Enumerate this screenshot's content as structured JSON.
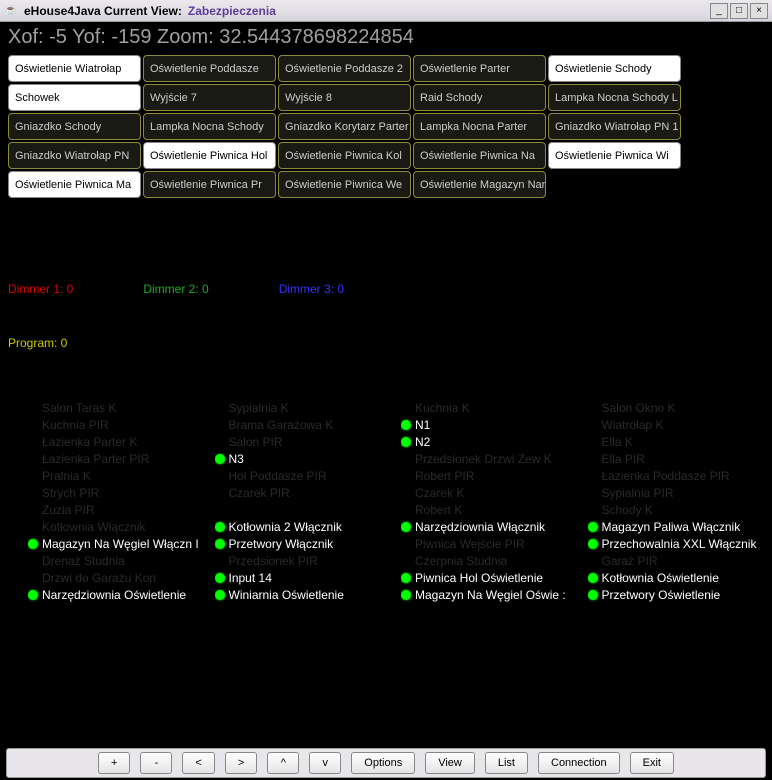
{
  "title": {
    "prefix": "eHouse4Java Current View:",
    "view": "Zabezpieczenia"
  },
  "win_buttons": {
    "min": "_",
    "max": "□",
    "close": "×"
  },
  "coords": "Xof: -5 Yof: -159 Zoom: 32.544378698224854",
  "cells": [
    {
      "label": "Oświetlenie Wiatrołap",
      "light": true
    },
    {
      "label": "Oświetlenie Poddasze",
      "light": false
    },
    {
      "label": "Oświetlenie Poddasze 2",
      "light": false
    },
    {
      "label": "Oświetlenie Parter",
      "light": false
    },
    {
      "label": "Oświetlenie Schody",
      "light": true
    },
    {
      "label": "Schowek",
      "light": true
    },
    {
      "label": "Wyjście 7",
      "light": false
    },
    {
      "label": "Wyjście 8",
      "light": false
    },
    {
      "label": "Raid Schody",
      "light": false
    },
    {
      "label": "Lampka Nocna Schody L",
      "light": false
    },
    {
      "label": "Gniazdko Schody",
      "light": false
    },
    {
      "label": "Lampka Nocna Schody",
      "light": false
    },
    {
      "label": "Gniazdko Korytarz Parter",
      "light": false
    },
    {
      "label": "Lampka Nocna Parter",
      "light": false
    },
    {
      "label": "Gniazdko Wiatrołap PN 1",
      "light": false
    },
    {
      "label": "Gniazdko Wiatrołap PN",
      "light": false
    },
    {
      "label": "Oświetlenie Piwnica Hol",
      "light": true
    },
    {
      "label": "Oświetlenie Piwnica Kol",
      "light": false
    },
    {
      "label": "Oświetlenie Piwnica Na",
      "light": false
    },
    {
      "label": "Oświetlenie Piwnica Wi",
      "light": true
    },
    {
      "label": "Oświetlenie Piwnica Ma",
      "light": true
    },
    {
      "label": "Oświetlenie Piwnica Pr",
      "light": false
    },
    {
      "label": "Oświetlenie Piwnica We",
      "light": false
    },
    {
      "label": "Oświetlenie Magazyn Narzędzia",
      "light": false
    }
  ],
  "dimmers": [
    {
      "label": "Dimmer 1: 0",
      "cls": "dimmer-red"
    },
    {
      "label": "Dimmer 2: 0",
      "cls": "dimmer-green"
    },
    {
      "label": "Dimmer 3: 0",
      "cls": "dimmer-blue"
    }
  ],
  "program": "Program: 0",
  "status_cols": [
    [
      {
        "label": "Salon Taras K",
        "dot": false,
        "on": false
      },
      {
        "label": "Kuchnia PIR",
        "dot": false,
        "on": false
      },
      {
        "label": "Łazienka Parter K",
        "dot": false,
        "on": false
      },
      {
        "label": "Łazienka Parter PIR",
        "dot": false,
        "on": false
      },
      {
        "label": "Pralnia K",
        "dot": false,
        "on": false
      },
      {
        "label": "Strych PIR",
        "dot": false,
        "on": false
      },
      {
        "label": "Zuzia PIR",
        "dot": false,
        "on": false
      },
      {
        "label": "Kotłownia Włącznik",
        "dot": false,
        "on": false
      },
      {
        "label": "Magazyn Na Węgiel Włączn I",
        "dot": true,
        "on": true
      },
      {
        "label": "Drenaż Studnia",
        "dot": false,
        "on": false
      },
      {
        "label": "Drzwi do Garażu Kon",
        "dot": false,
        "on": false
      },
      {
        "label": "Narzędziownia Oświetlenie",
        "dot": true,
        "on": true
      }
    ],
    [
      {
        "label": "Sypialnia K",
        "dot": false,
        "on": false
      },
      {
        "label": "Brama Garażowa K",
        "dot": false,
        "on": false
      },
      {
        "label": "Salon PIR",
        "dot": false,
        "on": false
      },
      {
        "label": "N3",
        "dot": true,
        "on": true
      },
      {
        "label": "Hol Poddasze PIR",
        "dot": false,
        "on": false
      },
      {
        "label": "Czarek PIR",
        "dot": false,
        "on": false
      },
      {
        "label": "",
        "dot": false,
        "on": false
      },
      {
        "label": "Kotłownia 2 Włącznik",
        "dot": true,
        "on": true
      },
      {
        "label": "Przetwory Włącznik",
        "dot": true,
        "on": true
      },
      {
        "label": "Przedsionek PIR",
        "dot": false,
        "on": false
      },
      {
        "label": "Input 14",
        "dot": true,
        "on": true
      },
      {
        "label": "Winiarnia Oświetlenie",
        "dot": true,
        "on": true
      }
    ],
    [
      {
        "label": "Kuchnia K",
        "dot": false,
        "on": false
      },
      {
        "label": "N1",
        "dot": true,
        "on": true
      },
      {
        "label": "N2",
        "dot": true,
        "on": true
      },
      {
        "label": "Przedsionek Drzwi Zew K",
        "dot": false,
        "on": false
      },
      {
        "label": "Robert PIR",
        "dot": false,
        "on": false
      },
      {
        "label": "Czarek K",
        "dot": false,
        "on": false
      },
      {
        "label": "Robert K",
        "dot": false,
        "on": false
      },
      {
        "label": "Narzędziownia Włącznik",
        "dot": true,
        "on": true
      },
      {
        "label": "Piwnica Wejście PIR",
        "dot": false,
        "on": false
      },
      {
        "label": "Czerpnia Studnia",
        "dot": false,
        "on": false
      },
      {
        "label": "Piwnica Hol Oświetlenie",
        "dot": true,
        "on": true
      },
      {
        "label": "Magazyn Na Węgiel Oświe    :",
        "dot": true,
        "on": true
      }
    ],
    [
      {
        "label": "Salon Okno K",
        "dot": false,
        "on": false
      },
      {
        "label": "Wiatrołap K",
        "dot": false,
        "on": false
      },
      {
        "label": "Ella K",
        "dot": false,
        "on": false
      },
      {
        "label": "Ella PIR",
        "dot": false,
        "on": false
      },
      {
        "label": "Łazienka Poddasze PIR",
        "dot": false,
        "on": false
      },
      {
        "label": "Sypialnia PIR",
        "dot": false,
        "on": false
      },
      {
        "label": "Schody K",
        "dot": false,
        "on": false
      },
      {
        "label": "Magazyn Paliwa Włącznik",
        "dot": true,
        "on": true
      },
      {
        "label": "Przechowalnia XXL Włącznik",
        "dot": true,
        "on": true
      },
      {
        "label": "Garaż PIR",
        "dot": false,
        "on": false
      },
      {
        "label": "Kotłownia Oświetlenie",
        "dot": true,
        "on": true
      },
      {
        "label": "Przetwory Oświetlenie",
        "dot": true,
        "on": true
      }
    ]
  ],
  "bottom": {
    "plus": "+",
    "minus": "-",
    "left": "<",
    "right": ">",
    "up": "^",
    "down": "v",
    "options": "Options",
    "view": "View",
    "list": "List",
    "connection": "Connection",
    "exit": "Exit"
  }
}
